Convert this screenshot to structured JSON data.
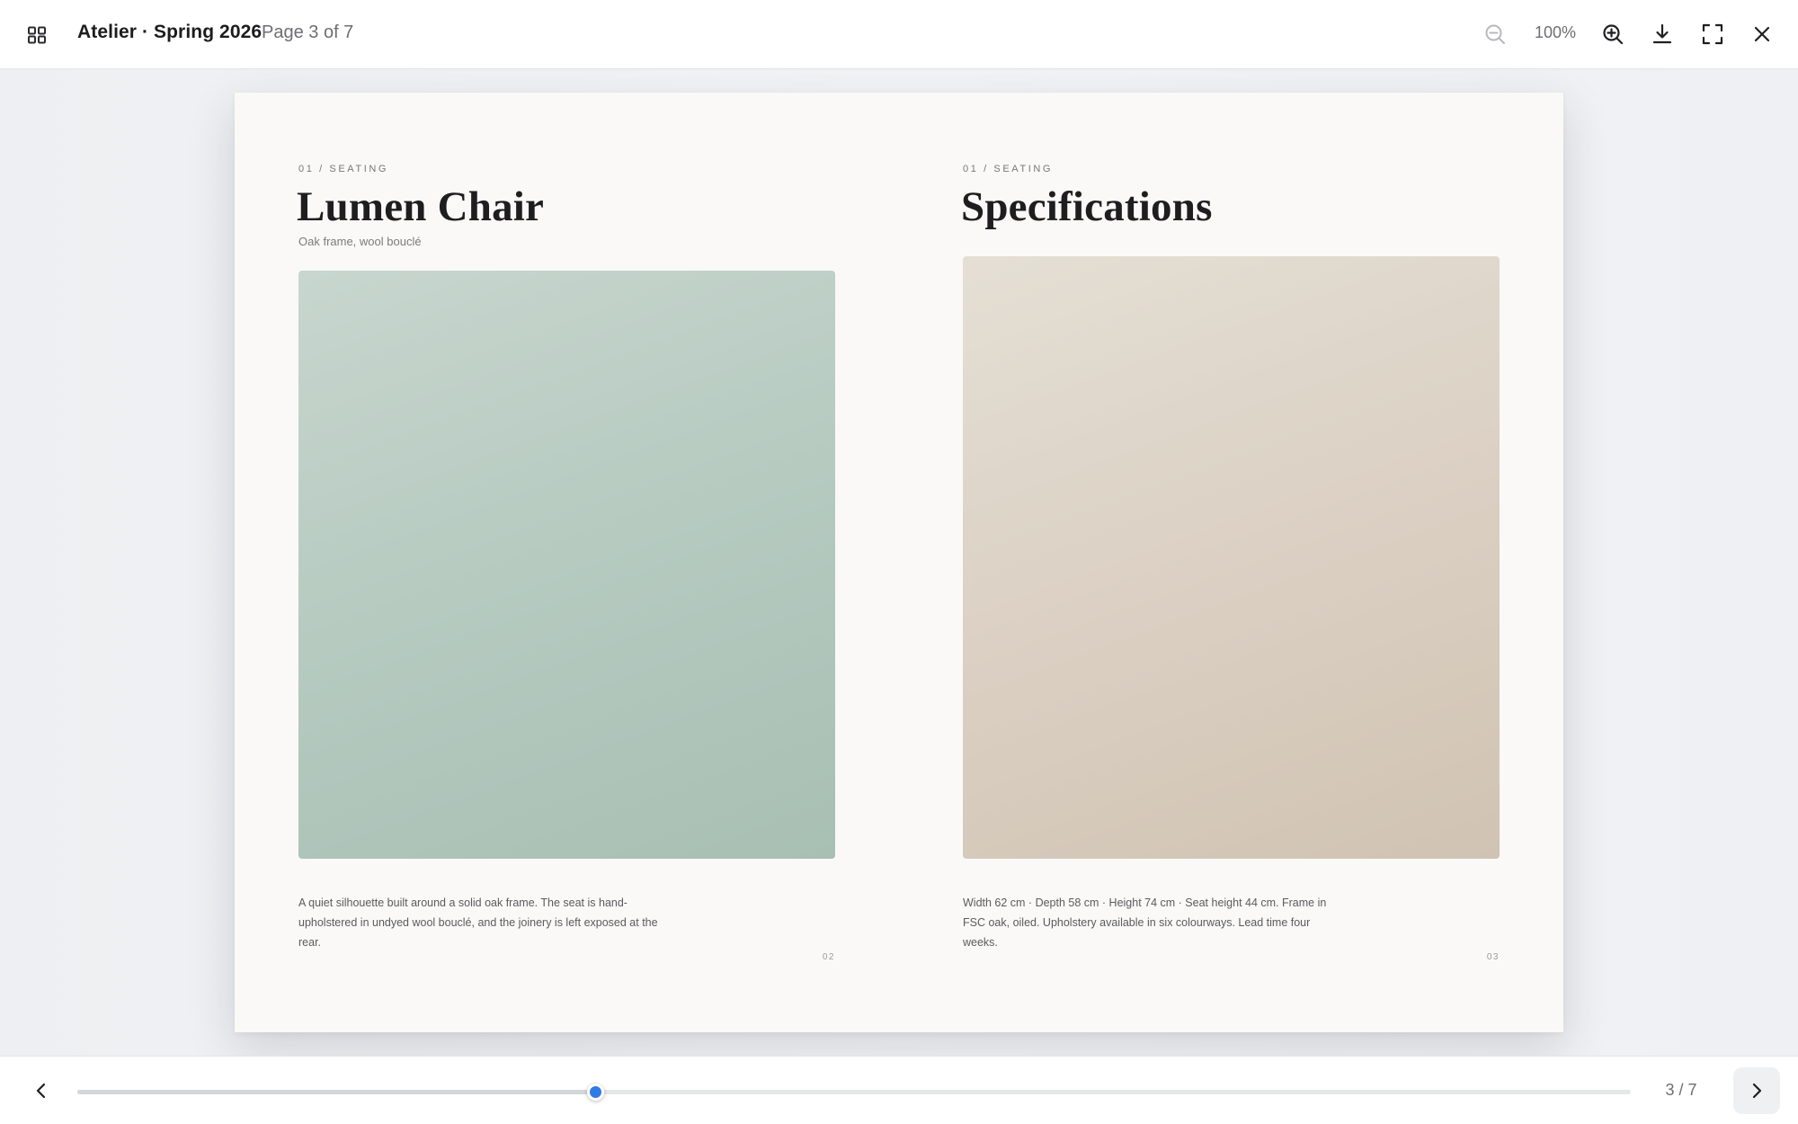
{
  "toolbar": {
    "document_title": "Atelier · Spring 2026",
    "page_indicator": "Page 3 of 7",
    "zoom_level": "100%",
    "icons": {
      "grid": "grid-view-icon",
      "zoom_out": "zoom-out-icon",
      "zoom_in": "zoom-in-icon",
      "download": "download-icon",
      "fullscreen": "fullscreen-icon",
      "close": "close-icon"
    }
  },
  "spread": {
    "left_page": {
      "kicker": "01 / SEATING",
      "title": "Lumen Chair",
      "subtitle": "Oak frame, wool bouclé",
      "image_color": "#b7cbc1",
      "body": "A quiet silhouette built around a solid oak frame. The seat is hand-upholstered in undyed wool bouclé, and the joinery is left exposed at the rear.",
      "folio": "02"
    },
    "right_page": {
      "kicker": "01 / SEATING",
      "title": "Specifications",
      "image_color": "#dbd0c3",
      "body": "Width 62 cm · Depth 58 cm · Height 74 cm · Seat height 44 cm. Frame in FSC oak, oiled. Upholstery available in six colourways. Lead time four weeks.",
      "folio": "03"
    }
  },
  "navigation": {
    "page_counter": "3 / 7",
    "current_page": 3,
    "total_pages": 7,
    "accent_color": "#2f7be6",
    "icons": {
      "previous": "chevron-left-icon",
      "next": "chevron-right-icon"
    }
  }
}
